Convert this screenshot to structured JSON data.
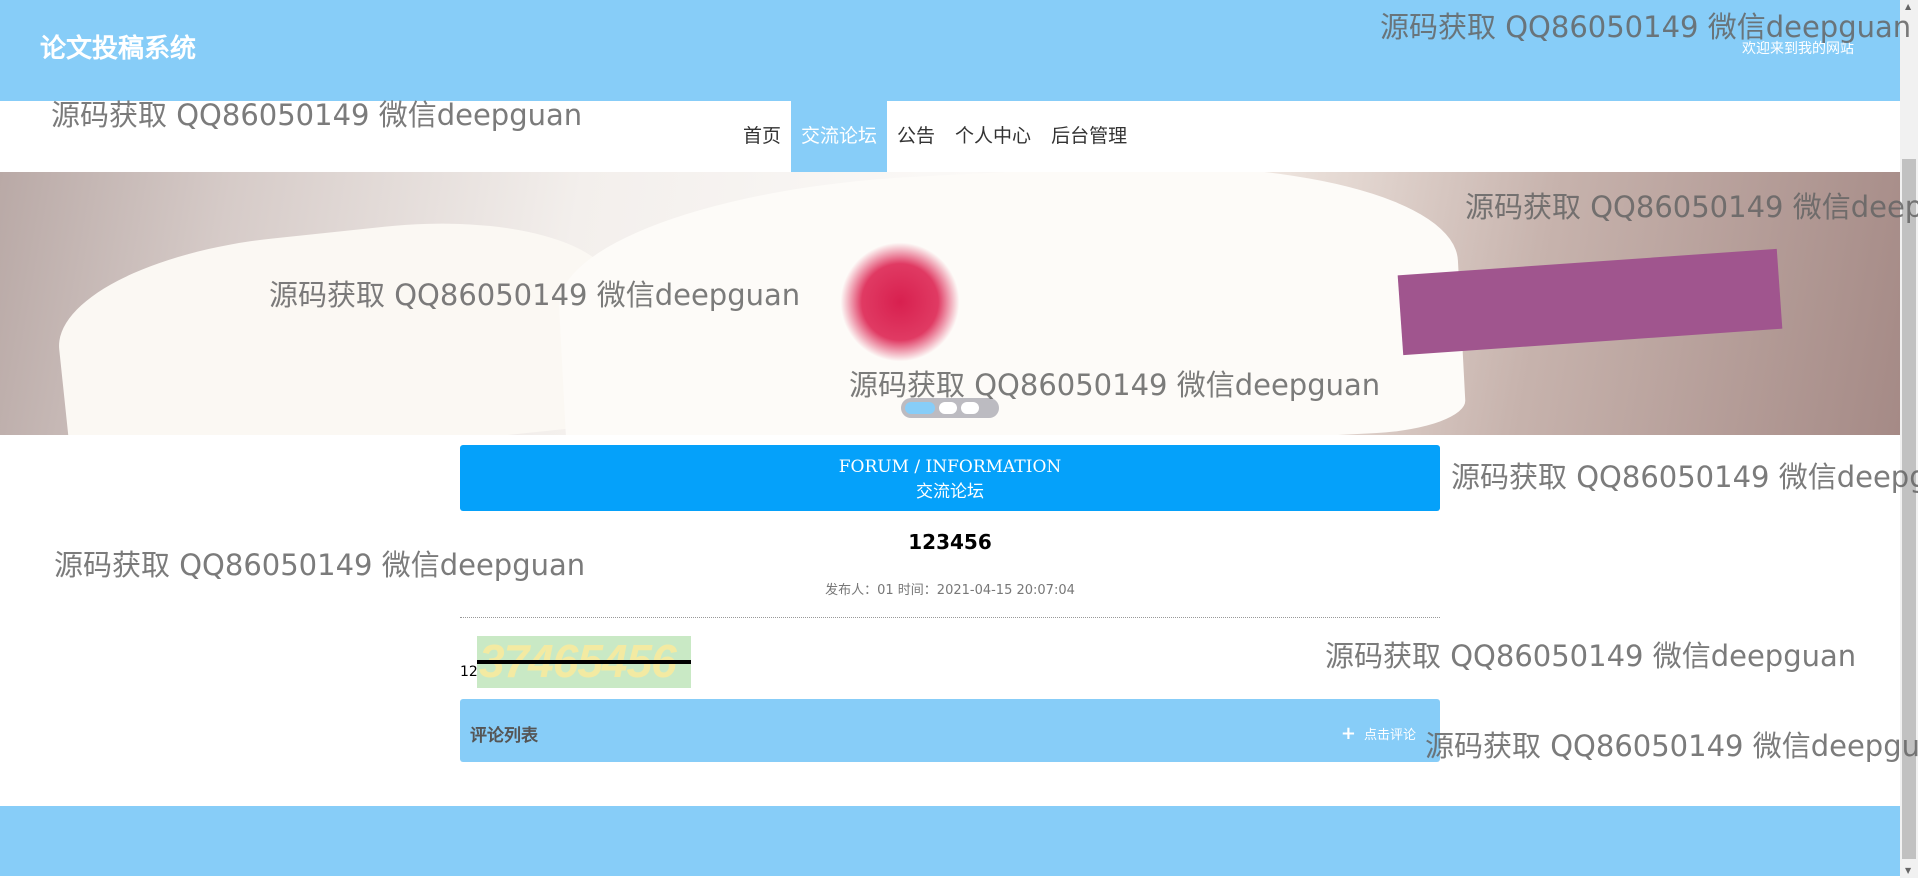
{
  "header": {
    "title": "论文投稿系统",
    "welcome": "欢迎来到我的网站"
  },
  "nav": {
    "items": [
      {
        "label": "首页"
      },
      {
        "label": "交流论坛",
        "active": true
      },
      {
        "label": "公告"
      },
      {
        "label": "个人中心"
      },
      {
        "label": "后台管理"
      }
    ]
  },
  "banner": {
    "slides": 3,
    "active_slide": 1
  },
  "forum": {
    "title_en": "FORUM / INFORMATION",
    "title_cn": "交流论坛"
  },
  "post": {
    "title": "123456",
    "meta": "发布人：01 时间：2021-04-15 20:07:04",
    "content": "12",
    "captcha_text": "37465456"
  },
  "comments": {
    "title": "评论列表",
    "add_label": "点击评论"
  },
  "watermark": "源码获取 QQ86050149 微信deepguan",
  "colors": {
    "header": "#87cdf8",
    "forum_box": "#05a1fa",
    "comment_bar": "#87cdf8"
  }
}
